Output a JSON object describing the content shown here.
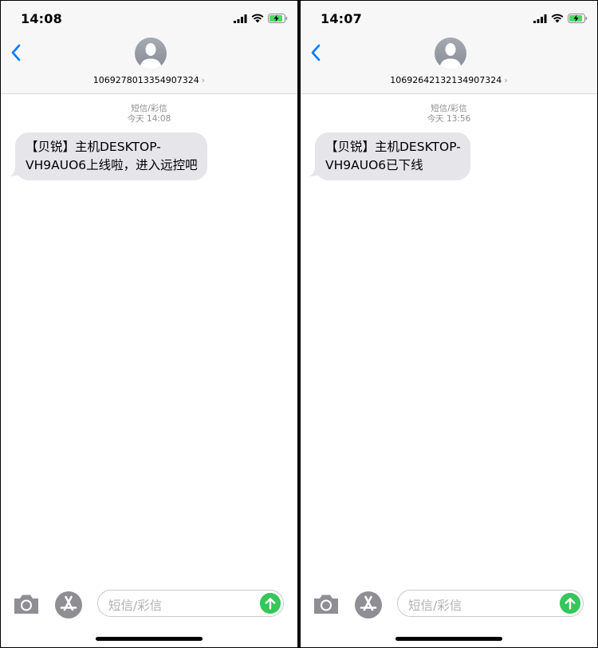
{
  "screens": [
    {
      "status": {
        "time": "14:08"
      },
      "contact": {
        "number": "1069278013354907324"
      },
      "message_meta": {
        "type": "短信/彩信",
        "time": "今天 14:08"
      },
      "message": {
        "line1": "【贝锐】主机DESKTOP-",
        "line2": "VH9AUO6上线啦，进入远控吧"
      },
      "input": {
        "placeholder": "短信/彩信"
      }
    },
    {
      "status": {
        "time": "14:07"
      },
      "contact": {
        "number": "1069264213213490732​4"
      },
      "message_meta": {
        "type": "短信/彩信",
        "time": "今天 13:56"
      },
      "message": {
        "line1": "【贝锐】主机DESKTOP-",
        "line2": "VH9AUO6已下线"
      },
      "input": {
        "placeholder": "短信/彩信"
      }
    }
  ],
  "icons": {
    "back": "chevron-left-icon",
    "signal": "cellular-signal-icon",
    "wifi": "wifi-icon",
    "battery": "battery-charging-icon",
    "camera": "camera-icon",
    "appstore": "app-store-icon",
    "send": "send-arrow-up-icon"
  },
  "colors": {
    "accent": "#007aff",
    "bubble": "#e5e5ea",
    "send": "#35c759",
    "battery": "#4cd964"
  }
}
